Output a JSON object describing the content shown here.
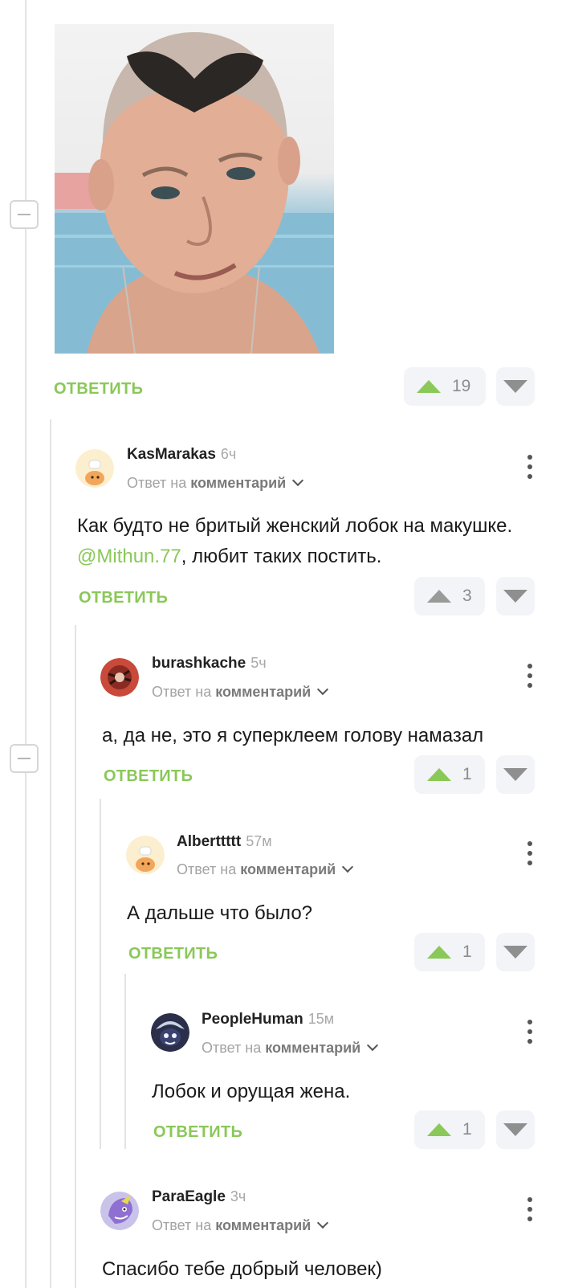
{
  "top": {
    "reply_label": "ОТВЕТИТЬ",
    "upvotes": "19"
  },
  "comments": [
    {
      "author": "KasMarakas",
      "time": "6ч",
      "reply_prefix": "Ответ на",
      "reply_link": "комментарий",
      "text_before": "Как будто не бритый женский лобок на макушке. ",
      "mention": "@Mithun.77",
      "text_after": ", любит таких постить.",
      "reply_label": "ОТВЕТИТЬ",
      "upvotes": "3",
      "upvote_active": false
    },
    {
      "author": "burashkache",
      "time": "5ч",
      "reply_prefix": "Ответ на",
      "reply_link": "комментарий",
      "text": "а, да не, это я суперклеем голову намазал",
      "reply_label": "ОТВЕТИТЬ",
      "upvotes": "1",
      "upvote_active": true
    },
    {
      "author": "Alberttttt",
      "time": "57м",
      "reply_prefix": "Ответ на",
      "reply_link": "комментарий",
      "text": "А дальше что было?",
      "reply_label": "ОТВЕТИТЬ",
      "upvotes": "1",
      "upvote_active": true
    },
    {
      "author": "PeopleHuman",
      "time": "15м",
      "reply_prefix": "Ответ на",
      "reply_link": "комментарий",
      "text": "Лобок и орущая жена.",
      "reply_label": "ОТВЕТИТЬ",
      "upvotes": "1",
      "upvote_active": true
    },
    {
      "author": "ParaEagle",
      "time": "3ч",
      "reply_prefix": "Ответ на",
      "reply_link": "комментарий",
      "text": "Спасибо тебе добрый человек)"
    }
  ],
  "colors": {
    "accent": "#8ac858",
    "vote_bg": "#f2f4f7",
    "muted": "#a3a3a3"
  }
}
